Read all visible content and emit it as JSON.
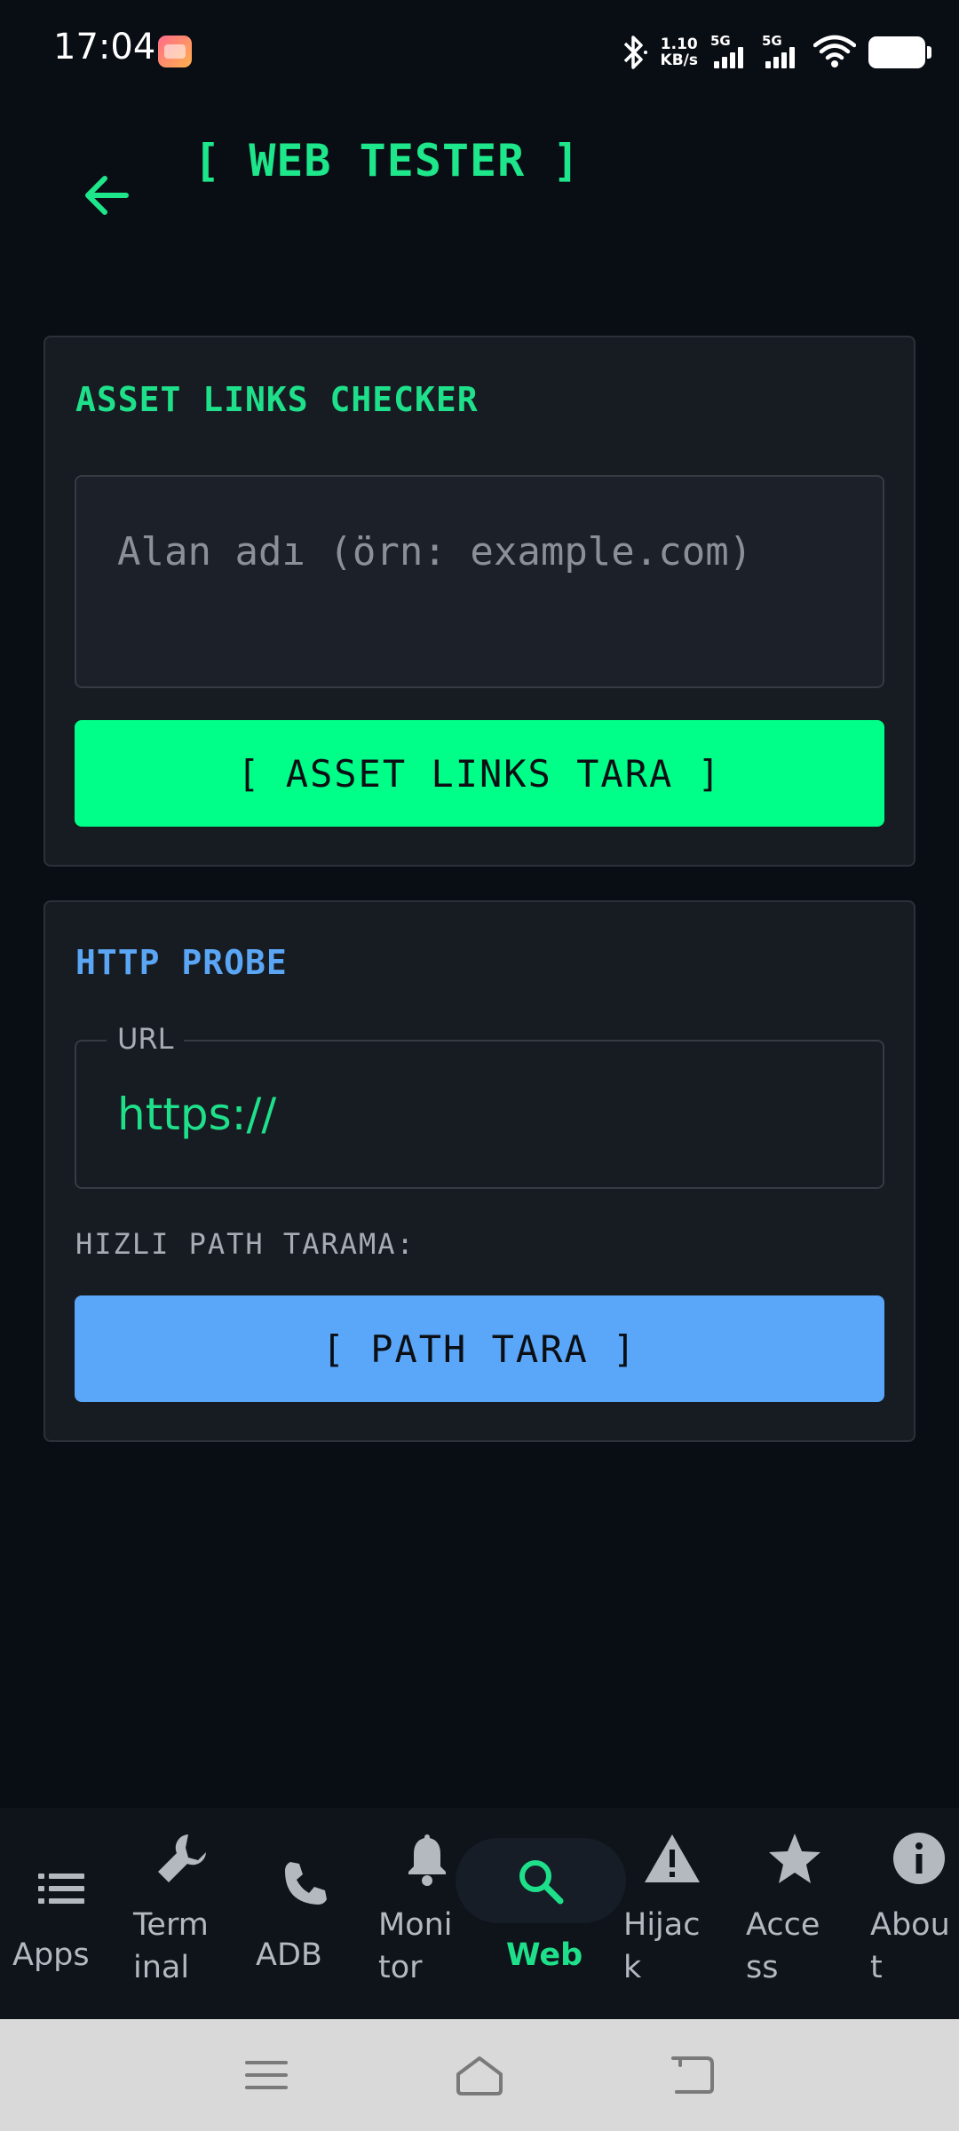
{
  "status_bar": {
    "time": "17:04",
    "net_speed_value": "1.10",
    "net_speed_unit": "KB/s",
    "signal1_tag": "5G",
    "signal2_tag": "5G",
    "icons": [
      "notification-app-icon",
      "bluetooth-icon",
      "signal-icon",
      "wifi-icon",
      "battery-icon"
    ]
  },
  "header": {
    "title": "[ WEB TESTER ]",
    "back_icon": "arrow-left-icon"
  },
  "asset_links": {
    "title": "ASSET LINKS CHECKER",
    "domain_placeholder": "Alan adı (örn: example.com)",
    "domain_value": "",
    "button_label": "[ ASSET LINKS TARA ]"
  },
  "http_probe": {
    "title": "HTTP PROBE",
    "url_label": "URL",
    "url_value": "https://",
    "path_section_label": "HIZLI PATH TARAMA:",
    "button_label": "[ PATH TARA ]"
  },
  "bottom_nav": {
    "items": [
      {
        "label": "Apps",
        "icon": "list-icon"
      },
      {
        "label": "Term\ninal",
        "icon": "wrench-icon"
      },
      {
        "label": "ADB",
        "icon": "phone-icon"
      },
      {
        "label": "Moni\ntor",
        "icon": "bell-icon"
      },
      {
        "label": "Web",
        "icon": "search-icon",
        "active": true
      },
      {
        "label": "Hijac\nk",
        "icon": "warning-icon"
      },
      {
        "label": "Acce\nss",
        "icon": "star-icon"
      },
      {
        "label": "Abou\nt",
        "icon": "info-icon"
      }
    ]
  },
  "system_nav": {
    "icons": [
      "menu-icon",
      "home-icon",
      "back-icon"
    ]
  },
  "colors": {
    "background": "#090d14",
    "card": "#171b22",
    "accent_green": "#00ff88",
    "title_green": "#1ee68a",
    "accent_blue": "#5aa6f8"
  }
}
